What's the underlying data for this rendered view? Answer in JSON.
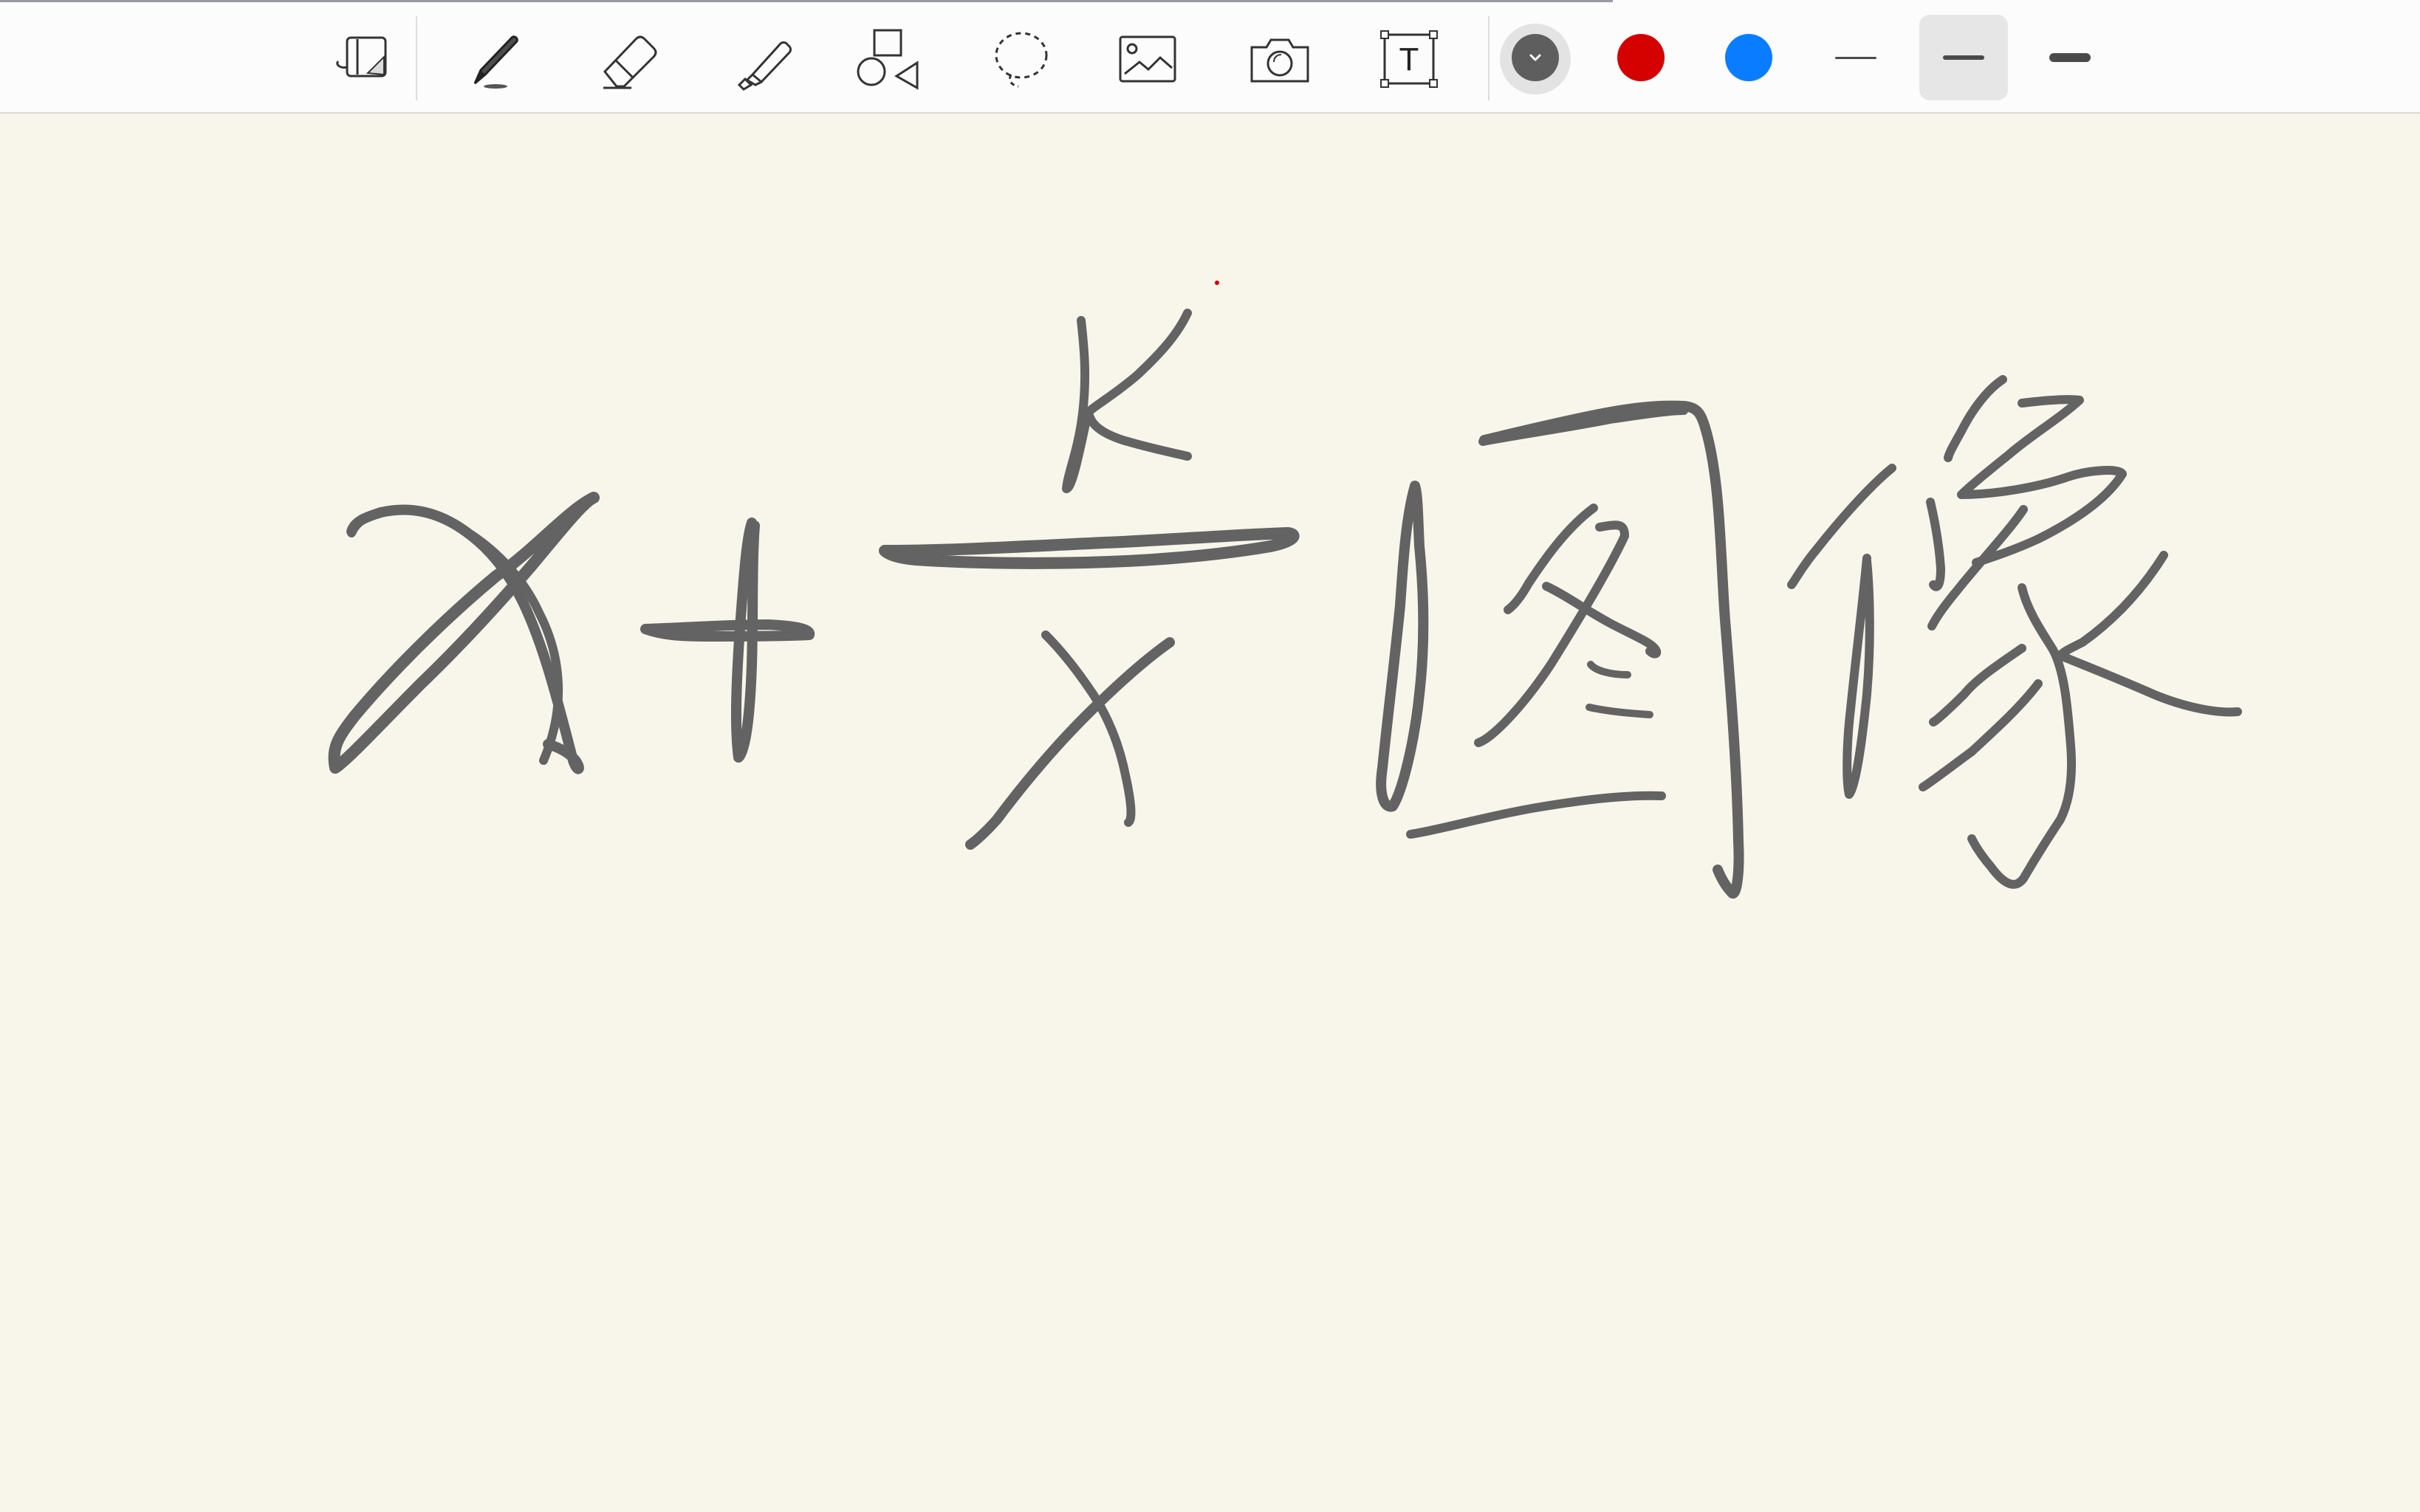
{
  "toolbar": {
    "tools": [
      {
        "name": "page-layout-icon"
      },
      {
        "name": "pen-icon"
      },
      {
        "name": "eraser-icon"
      },
      {
        "name": "highlighter-icon"
      },
      {
        "name": "shapes-icon"
      },
      {
        "name": "lasso-icon"
      },
      {
        "name": "image-icon"
      },
      {
        "name": "camera-icon"
      },
      {
        "name": "text-box-icon"
      }
    ],
    "text_box_glyph": "T",
    "colors": {
      "dark_gray": "#5E5E5E",
      "red": "#D50000",
      "blue": "#0A7CFF",
      "selected": "dark_gray"
    },
    "stroke_widths": [
      "thin",
      "medium",
      "thick"
    ],
    "selected_stroke": "medium"
  },
  "canvas": {
    "background": "#F8F6EA",
    "ink_color": "#636363",
    "handwriting": [
      "x",
      "+",
      "k",
      "x",
      "图",
      "像"
    ]
  }
}
